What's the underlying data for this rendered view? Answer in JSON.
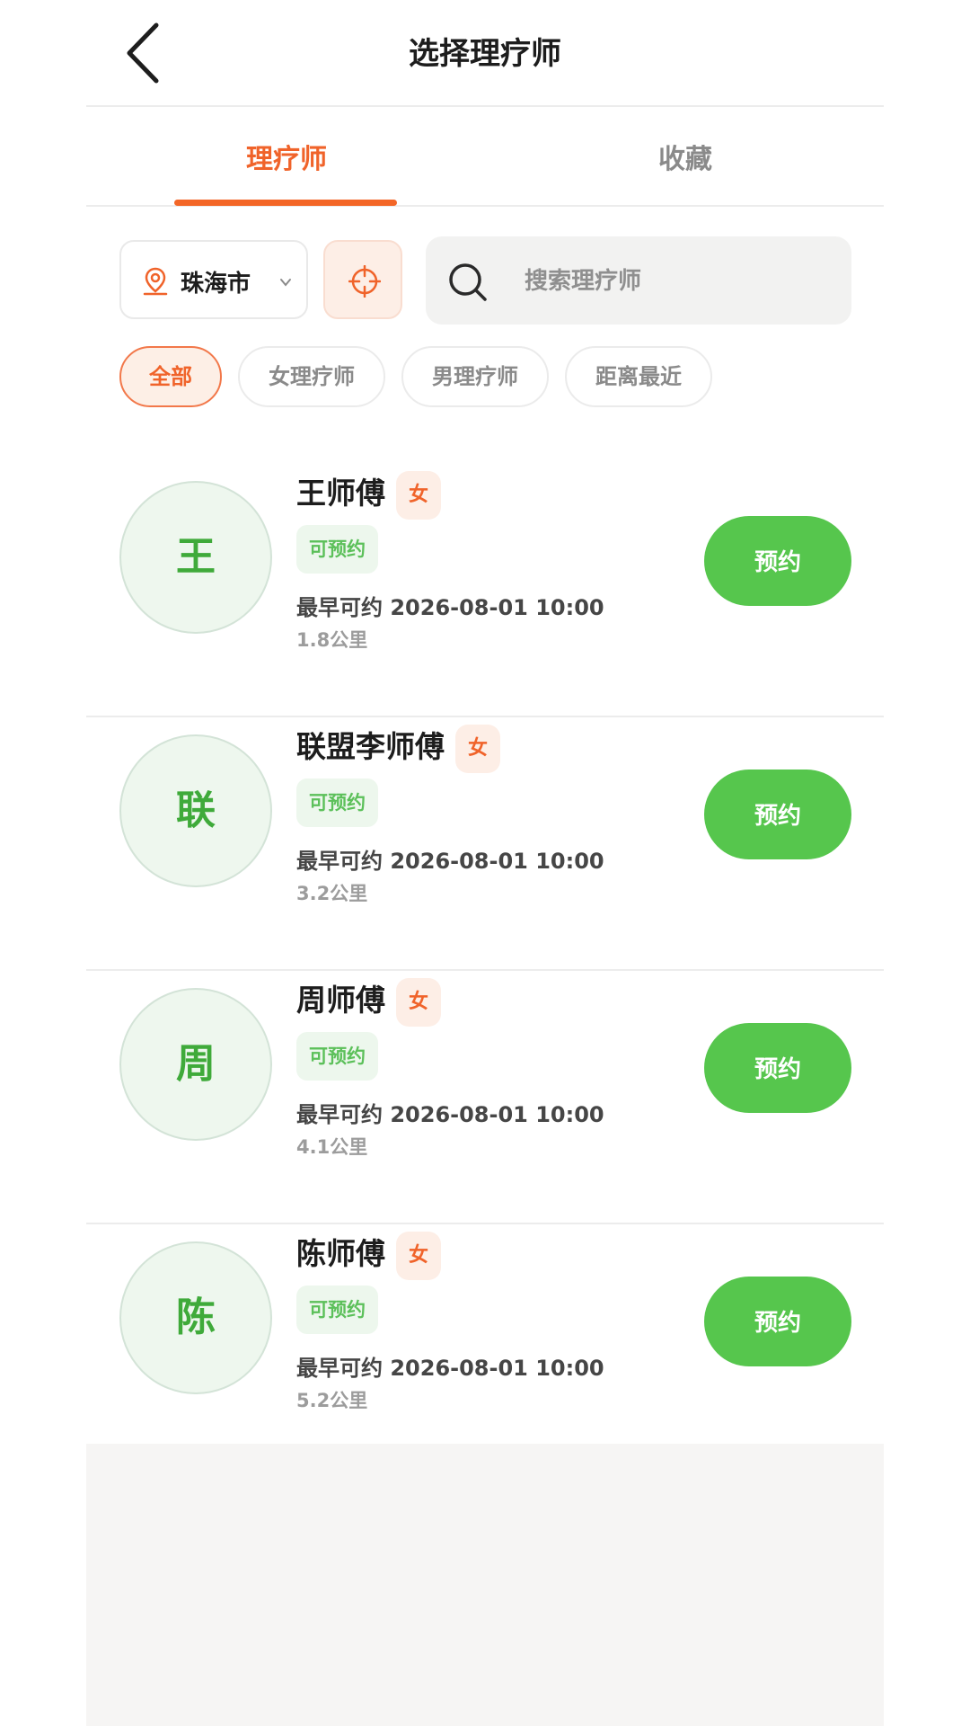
{
  "header": {
    "title": "选择理疗师"
  },
  "tabs": [
    {
      "label": "理疗师",
      "active": true
    },
    {
      "label": "收藏",
      "active": false
    }
  ],
  "filters": {
    "city": "珠海市",
    "search_placeholder": "搜索理疗师",
    "chips": [
      {
        "label": "全部",
        "active": true
      },
      {
        "label": "女理疗师",
        "active": false
      },
      {
        "label": "男理疗师",
        "active": false
      },
      {
        "label": "距离最近",
        "active": false
      }
    ]
  },
  "therapists": [
    {
      "avatar": "王",
      "name": "王师傅",
      "gender": "女",
      "status": "可预约",
      "earliest": "最早可约 2026-08-01 10:00",
      "distance": "1.8公里",
      "action": "预约"
    },
    {
      "avatar": "联",
      "name": "联盟李师傅",
      "gender": "女",
      "status": "可预约",
      "earliest": "最早可约 2026-08-01 10:00",
      "distance": "3.2公里",
      "action": "预约"
    },
    {
      "avatar": "周",
      "name": "周师傅",
      "gender": "女",
      "status": "可预约",
      "earliest": "最早可约 2026-08-01 10:00",
      "distance": "4.1公里",
      "action": "预约"
    },
    {
      "avatar": "陈",
      "name": "陈师傅",
      "gender": "女",
      "status": "可预约",
      "earliest": "最早可约 2026-08-01 10:00",
      "distance": "5.2公里",
      "action": "预约"
    }
  ],
  "colors": {
    "accent": "#f36627",
    "book_button": "#56c64d",
    "status_text": "#5cc05a",
    "avatar_text": "#3faa3a"
  },
  "icons": {
    "back": "chevron-left-icon",
    "location": "map-pin-icon",
    "dropdown": "chevron-down-icon",
    "locate": "crosshair-icon",
    "search": "search-icon"
  }
}
